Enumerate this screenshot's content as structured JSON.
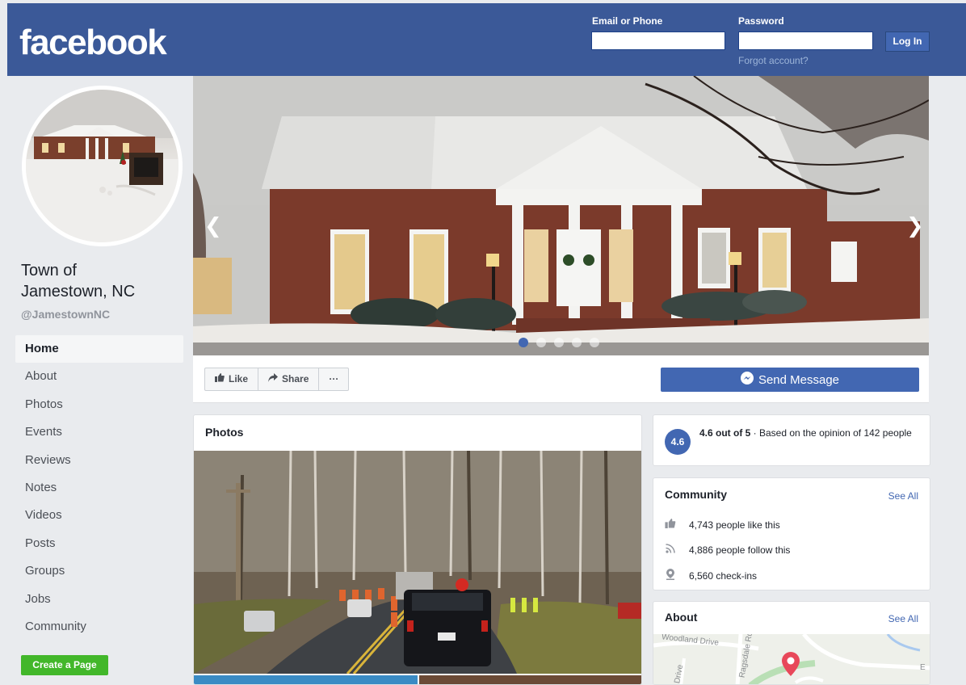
{
  "header": {
    "logo": "facebook",
    "email_label": "Email or Phone",
    "password_label": "Password",
    "login_button": "Log In",
    "forgot_link": "Forgot account?"
  },
  "page": {
    "name_line1": "Town of",
    "name_line2": "Jamestown, NC",
    "handle": "@JamestownNC"
  },
  "nav": {
    "items": [
      "Home",
      "About",
      "Photos",
      "Events",
      "Reviews",
      "Notes",
      "Videos",
      "Posts",
      "Groups",
      "Jobs",
      "Community"
    ],
    "active": "Home",
    "create_page": "Create a Page"
  },
  "cover": {
    "slide_count": 5,
    "active_slide": 1
  },
  "actions": {
    "like": "Like",
    "share": "Share",
    "more": "···",
    "send_message": "Send Message"
  },
  "photos": {
    "title": "Photos"
  },
  "rating": {
    "score": "4.6",
    "summary_bold": "4.6 out of 5",
    "summary_rest": " · Based on the opinion of 142 people"
  },
  "community": {
    "title": "Community",
    "see_all": "See All",
    "likes": "4,743 people like this",
    "follows": "4,886 people follow this",
    "checkins": "6,560 check-ins"
  },
  "about": {
    "title": "About",
    "see_all": "See All",
    "map_labels": [
      "Woodland Drive",
      "Ragsdale Rd",
      "Drive",
      "E"
    ]
  },
  "colors": {
    "brand": "#3b5998",
    "button": "#4267b2",
    "create_page": "#42b72a",
    "background": "#e9ebee"
  }
}
